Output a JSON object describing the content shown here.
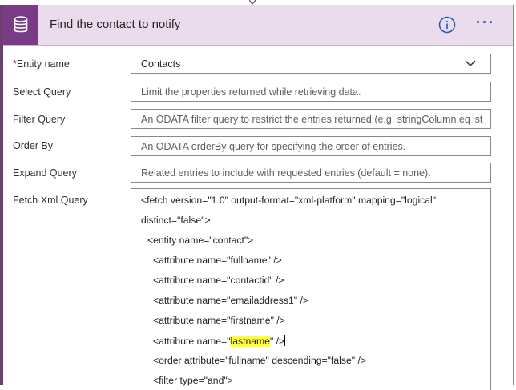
{
  "action": {
    "title": "Find the contact to notify",
    "info_icon": "info-icon",
    "more_icon": "more-options-icon",
    "more_glyph": "···"
  },
  "fields": {
    "entity_name": {
      "required_mark": "*",
      "label": "Entity name",
      "value": "Contacts"
    },
    "select_query": {
      "label": "Select Query",
      "placeholder": "Limit the properties returned while retrieving data."
    },
    "filter_query": {
      "label": "Filter Query",
      "placeholder": "An ODATA filter query to restrict the entries returned (e.g. stringColumn eq 'st"
    },
    "order_by": {
      "label": "Order By",
      "placeholder": "An ODATA orderBy query for specifying the order of entries."
    },
    "expand_query": {
      "label": "Expand Query",
      "placeholder": "Related entries to include with requested entries (default = none)."
    },
    "fetch_xml": {
      "label": "Fetch Xml Query",
      "lines": [
        "<fetch version=\"1.0\" output-format=\"xml-platform\" mapping=\"logical\"",
        "distinct=\"false\">",
        "<entity name=\"contact\">",
        "<attribute name=\"fullname\" />",
        "<attribute name=\"contactid\" />",
        "<attribute name=\"emailaddress1\" />",
        "<attribute name=\"firstname\" />",
        "<attribute name=\"",
        "lastname",
        "\" />",
        "<order attribute=\"fullname\" descending=\"false\" />",
        "<filter type=\"and\">"
      ]
    }
  },
  "colors": {
    "accent": "#7a3b86",
    "header_bg": "#eadced",
    "highlight": "#ffff3a",
    "link_blue": "#1f5bb8"
  }
}
